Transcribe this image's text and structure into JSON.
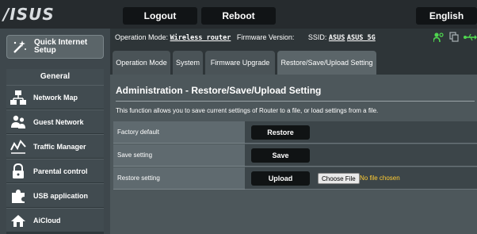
{
  "brand": {
    "logo_text": "/ISUS"
  },
  "topbar": {
    "logout": "Logout",
    "reboot": "Reboot",
    "language": "English"
  },
  "quick_setup": {
    "label": "Quick Internet Setup"
  },
  "sidebar": {
    "section_header": "General",
    "items": [
      {
        "label": "Network Map",
        "icon": "network-map-icon"
      },
      {
        "label": "Guest Network",
        "icon": "guest-network-icon"
      },
      {
        "label": "Traffic Manager",
        "icon": "traffic-manager-icon"
      },
      {
        "label": "Parental control",
        "icon": "lock-icon"
      },
      {
        "label": "USB application",
        "icon": "puzzle-icon"
      },
      {
        "label": "AiCloud",
        "icon": "cloud-home-icon"
      }
    ]
  },
  "status": {
    "op_mode_label": "Operation Mode:",
    "op_mode_value": "Wireless router",
    "firmware_label": "Firmware Version:",
    "ssid_label": "SSID:",
    "ssid_1": "ASUS",
    "ssid_2": "ASUS_5G"
  },
  "tabs": [
    {
      "label": "Operation Mode"
    },
    {
      "label": "System"
    },
    {
      "label": "Firmware Upgrade"
    },
    {
      "label": "Restore/Save/Upload Setting"
    }
  ],
  "content": {
    "title": "Administration - Restore/Save/Upload Setting",
    "description": "This function allows you to save current settings of Router to a file, or load settings from a file.",
    "rows": [
      {
        "label": "Factory default",
        "button": "Restore"
      },
      {
        "label": "Save setting",
        "button": "Save"
      },
      {
        "label": "Restore setting",
        "button": "Upload"
      }
    ],
    "choose_file": "Choose File",
    "no_file": "No file chosen"
  },
  "colors": {
    "topbar": "#262b2e",
    "sidebar": "#3e474c",
    "content": "#4d575b",
    "accent_green": "#4fd64f",
    "no_file_text": "#ffcc33"
  }
}
